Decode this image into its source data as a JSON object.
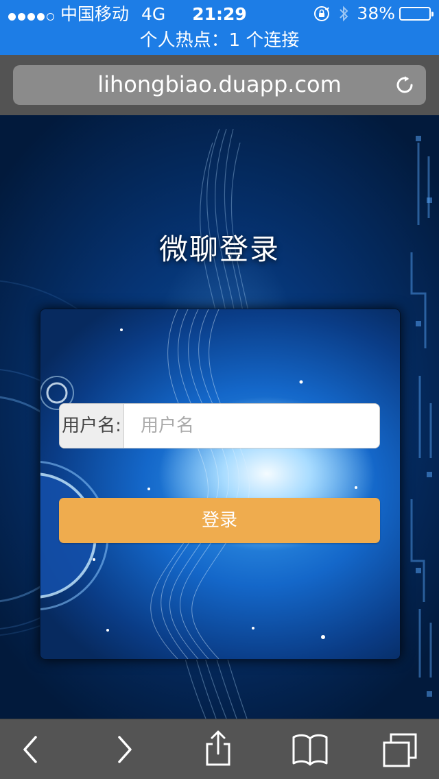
{
  "status_bar": {
    "carrier": "中国移动",
    "network": "4G",
    "time": "21:29",
    "battery": "38%",
    "battery_level": 0.38,
    "hotspot": "个人热点：1 个连接",
    "bg_color": "#1d7de6"
  },
  "browser": {
    "url": "lihongbiao.duapp.com",
    "reload_icon": "reload-icon",
    "toolbar_icons": [
      "back-icon",
      "forward-icon",
      "share-icon",
      "bookmarks-icon",
      "tabs-icon"
    ]
  },
  "page": {
    "title": "微聊登录",
    "form": {
      "username_label": "用户名:",
      "username_placeholder": "用户名",
      "username_value": "",
      "submit_label": "登录",
      "submit_color": "#efac4e"
    }
  }
}
